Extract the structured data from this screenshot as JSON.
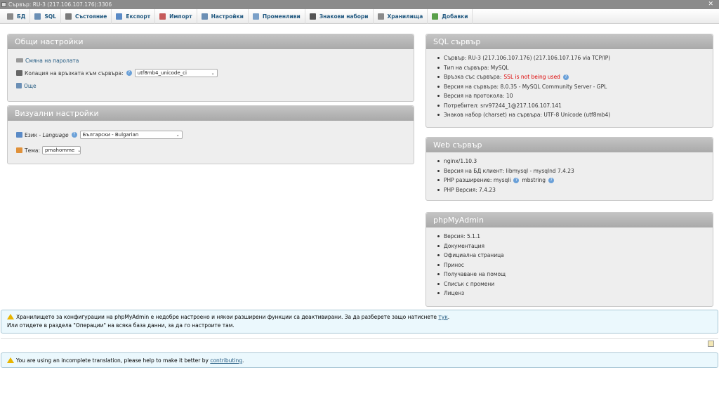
{
  "window": {
    "title": "Сървър: RU-3 (217.106.107.176):3306"
  },
  "menu": [
    {
      "label": "БД",
      "icon": "database-icon",
      "color": "#8a8a8a"
    },
    {
      "label": "SQL",
      "icon": "sql-icon",
      "color": "#6b8fb5"
    },
    {
      "label": "Състояние",
      "icon": "status-icon",
      "color": "#7a7a7a"
    },
    {
      "label": "Експорт",
      "icon": "export-icon",
      "color": "#5a8ac6"
    },
    {
      "label": "Импорт",
      "icon": "import-icon",
      "color": "#c65a5a"
    },
    {
      "label": "Настройки",
      "icon": "wrench-icon",
      "color": "#6b8fb5"
    },
    {
      "label": "Променливи",
      "icon": "variables-icon",
      "color": "#7aa0c8"
    },
    {
      "label": "Знакови набори",
      "icon": "charset-icon",
      "color": "#555555"
    },
    {
      "label": "Хранилища",
      "icon": "engines-icon",
      "color": "#8a8a8a"
    },
    {
      "label": "Добавки",
      "icon": "plugins-icon",
      "color": "#5aa04a"
    }
  ],
  "general": {
    "title": "Общи настройки",
    "change_password": "Смяна на паролата",
    "collation_label": "Колация на връзката към сървъра:",
    "collation_value": "utf8mb4_unicode_ci",
    "more": "Още"
  },
  "visual": {
    "title": "Визуални настройки",
    "language_label": "Език - ",
    "language_label_em": "Language",
    "language_value": "Български - Bulgarian",
    "theme_label": "Тема:",
    "theme_value": "pmahomme"
  },
  "sql_server": {
    "title": "SQL сървър",
    "items": [
      "Сървър: RU-3 (217.106.107.176) (217.106.107.176 via TCP/IP)",
      "Тип на сървъра: MySQL",
      "Версия на сървъра: 8.0.35 - MySQL Community Server - GPL",
      "Версия на протокола: 10",
      "Потребител: srv97244_1@217.106.107.141",
      "Знаков набор (charset) на сървъра: UTF-8 Unicode (utf8mb4)"
    ],
    "ssl_label": "Връзка със сървъра:",
    "ssl_value": "SSL is not being used"
  },
  "web_server": {
    "title": "Web сървър",
    "items": [
      "nginx/1.10.3",
      "Версия на БД клиент: libmysql - mysqlnd 7.4.23",
      "PHP Версия: 7.4.23"
    ],
    "php_ext_label": "PHP разширение: mysqli",
    "php_ext_extra": "mbstring"
  },
  "pma": {
    "title": "phpMyAdmin",
    "version": "Версия: 5.1.1",
    "links": [
      "Документация",
      "Официална страница",
      "Принос",
      "Получаване на помощ",
      "Списък с промени",
      "Лиценз"
    ]
  },
  "notice_config": {
    "line1": "Хранилището за конфигурации на phpMyAdmin е недобре настроено и някои разширени функции са деактивирани. За да разберете защо натиснете ",
    "link": "тук",
    "line1_end": ".",
    "line2": "Или отидете в раздела \"Операции\" на всяка база данни, за да го настроите там."
  },
  "notice_translation": {
    "text": "You are using an incomplete translation, please help to make it better by ",
    "link": "contributing",
    "end": "."
  }
}
